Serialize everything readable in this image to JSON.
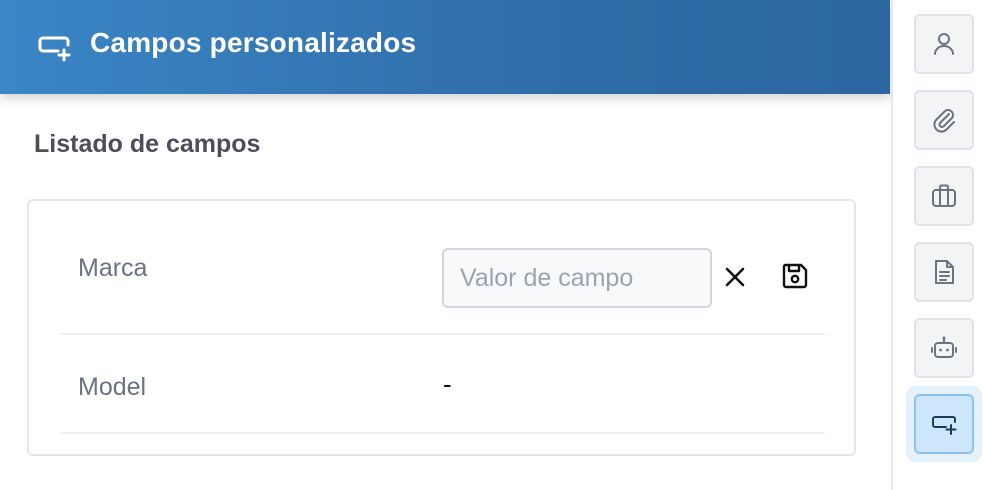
{
  "header": {
    "title": "Campos personalizados",
    "icon": "custom-field-icon"
  },
  "section": {
    "title": "Listado de campos"
  },
  "fields": [
    {
      "label": "Marca",
      "input_placeholder": "Valor de campo",
      "input_value": ""
    },
    {
      "label": "Model",
      "value": "-"
    }
  ],
  "sidebar": {
    "items": [
      {
        "icon": "user-icon",
        "active": false
      },
      {
        "icon": "paperclip-icon",
        "active": false
      },
      {
        "icon": "briefcase-icon",
        "active": false
      },
      {
        "icon": "document-icon",
        "active": false
      },
      {
        "icon": "robot-icon",
        "active": false
      },
      {
        "icon": "custom-field-icon",
        "active": true
      }
    ]
  },
  "colors": {
    "header_gradient_start": "#3b86c6",
    "header_gradient_end": "#2c66a0",
    "active_bg": "#cde6fb",
    "active_border": "#8cc2ee"
  }
}
